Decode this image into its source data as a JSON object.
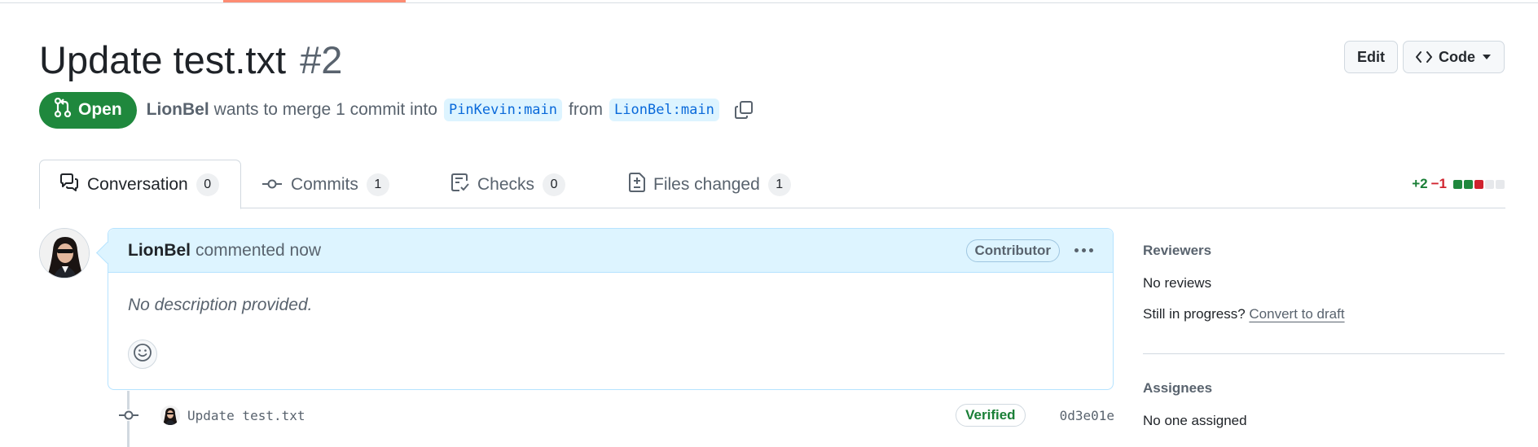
{
  "pull_request": {
    "title": "Update test.txt",
    "number": "#2",
    "state": "Open",
    "author": "LionBel",
    "merge_text": "wants to merge 1 commit into",
    "base_branch": "PinKevin:main",
    "from_text": "from",
    "head_branch": "LionBel:main"
  },
  "actions": {
    "edit_label": "Edit",
    "code_label": "Code"
  },
  "tabs": [
    {
      "label": "Conversation",
      "count": "0",
      "icon": "comment-discussion-icon"
    },
    {
      "label": "Commits",
      "count": "1",
      "icon": "git-commit-icon"
    },
    {
      "label": "Checks",
      "count": "0",
      "icon": "checklist-icon"
    },
    {
      "label": "Files changed",
      "count": "1",
      "icon": "file-diff-icon"
    }
  ],
  "diffstat": {
    "additions": "+2",
    "deletions": "−1",
    "blocks": [
      "green",
      "green",
      "red",
      "gray",
      "gray"
    ],
    "colors": {
      "green": "#1f883d",
      "red": "#cf222e",
      "gray": "#e6e8eb"
    }
  },
  "comment": {
    "author": "LionBel",
    "action": "commented now",
    "badge": "Contributor",
    "body": "No description provided."
  },
  "commit": {
    "message": "Update test.txt",
    "verified": "Verified",
    "sha": "0d3e01e"
  },
  "sidebar": {
    "reviewers": {
      "heading": "Reviewers",
      "value": "No reviews",
      "progress_text": "Still in progress?",
      "draft_link": "Convert to draft"
    },
    "assignees": {
      "heading": "Assignees",
      "value": "No one assigned"
    }
  },
  "colors": {
    "accent_orange": "#fd8c73",
    "open_green": "#1f883d",
    "link_blue": "#0969da",
    "comment_header_bg": "#ddf4ff"
  }
}
